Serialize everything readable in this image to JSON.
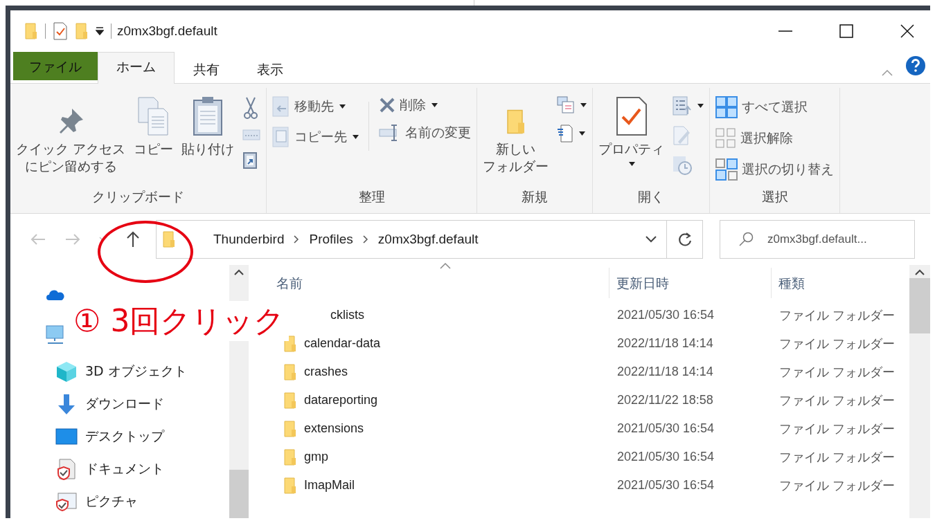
{
  "title_bar": {
    "title": "z0mx3bgf.default"
  },
  "ribbon_tabs": [
    {
      "label": "ファイル",
      "kind": "file",
      "selected": false
    },
    {
      "label": "ホーム",
      "kind": "tab",
      "selected": true
    },
    {
      "label": "共有",
      "kind": "tab",
      "selected": false
    },
    {
      "label": "表示",
      "kind": "tab",
      "selected": false
    }
  ],
  "ribbon_groups": [
    {
      "label": "クリップボード",
      "columns": [
        {
          "kind": "large",
          "label_lines": [
            "クイック アクセス",
            "にピン留めする"
          ],
          "dropdown": false
        },
        {
          "kind": "large",
          "label_lines": [
            "コピー"
          ],
          "dropdown": false
        },
        {
          "kind": "large",
          "label_lines": [
            "貼り付け"
          ],
          "dropdown": false
        },
        {
          "kind": "stack",
          "items": [
            {
              "dropdown": false
            },
            {
              "dropdown": false
            },
            {
              "dropdown": false
            }
          ]
        }
      ]
    },
    {
      "label": "整理",
      "columns": [
        {
          "kind": "stack",
          "items": [
            {
              "label": "移動先",
              "dropdown": true
            },
            {
              "label": "コピー先",
              "dropdown": true
            }
          ]
        },
        {
          "kind": "divider"
        },
        {
          "kind": "stack",
          "items": [
            {
              "label": "削除",
              "dropdown": true
            },
            {
              "label": "名前の変更",
              "dropdown": false
            }
          ]
        }
      ]
    },
    {
      "label": "新規",
      "columns": [
        {
          "kind": "large",
          "label_lines": [
            "新しい",
            "フォルダー"
          ],
          "dropdown": false
        },
        {
          "kind": "stack",
          "items": [
            {
              "dropdown": true
            },
            {
              "dropdown": true
            }
          ]
        }
      ]
    },
    {
      "label": "開く",
      "columns": [
        {
          "kind": "large",
          "label_lines": [
            "プロパティ"
          ],
          "dropdown": true
        },
        {
          "kind": "stack",
          "items": [
            {
              "dropdown": true
            },
            {
              "dropdown": false
            },
            {
              "dropdown": false
            }
          ]
        }
      ]
    },
    {
      "label": "選択",
      "columns": [
        {
          "kind": "stack",
          "items": [
            {
              "label": "すべて選択",
              "dropdown": false
            },
            {
              "label": "選択解除",
              "dropdown": false
            },
            {
              "label": "選択の切り替え",
              "dropdown": false
            }
          ]
        }
      ]
    }
  ],
  "address_bar": {
    "path": [
      "Thunderbird",
      "Profiles",
      "z0mx3bgf.default"
    ],
    "search": {
      "placeholder": "z0mx3bgf.default..."
    }
  },
  "nav_pane": {
    "items": [
      {
        "kind": "cloud"
      },
      {
        "kind": "pc"
      },
      {
        "kind": "cube",
        "label": "3D オブジェクト"
      },
      {
        "kind": "download",
        "label": "ダウンロード"
      },
      {
        "kind": "desktop",
        "label": "デスクトップ"
      },
      {
        "kind": "document",
        "label": "ドキュメント"
      },
      {
        "kind": "picture",
        "label": "ピクチャ"
      }
    ]
  },
  "file_list": {
    "columns": [
      "名前",
      "更新日時",
      "種類"
    ],
    "rows": [
      {
        "name": "cklists",
        "covered": true,
        "date": "2021/05/30 16:54",
        "type": "ファイル フォルダー"
      },
      {
        "name": "calendar-data",
        "covered": false,
        "date": "2022/11/18 14:14",
        "type": "ファイル フォルダー"
      },
      {
        "name": "crashes",
        "covered": false,
        "date": "2022/11/18 14:14",
        "type": "ファイル フォルダー"
      },
      {
        "name": "datareporting",
        "covered": false,
        "date": "2022/11/22 18:58",
        "type": "ファイル フォルダー"
      },
      {
        "name": "extensions",
        "covered": false,
        "date": "2021/05/30 16:54",
        "type": "ファイル フォルダー"
      },
      {
        "name": "gmp",
        "covered": false,
        "date": "2021/05/30 16:54",
        "type": "ファイル フォルダー"
      },
      {
        "name": "ImapMail",
        "covered": false,
        "date": "2021/05/30 16:54",
        "type": "ファイル フォルダー"
      }
    ]
  },
  "annotation": {
    "text": "① 3回クリック"
  }
}
